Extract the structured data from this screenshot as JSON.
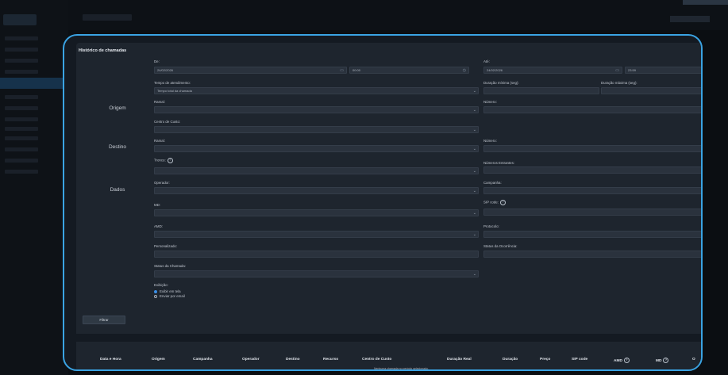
{
  "panel": {
    "title": "Histórico de chamadas"
  },
  "sections": {
    "origem": "Origem",
    "destino": "Destino",
    "dados": "Dados"
  },
  "filters": {
    "de_label": "De:",
    "de_date": "24/02/2026",
    "de_time": "00:00",
    "ate_label": "Até:",
    "ate_date": "24/02/2026",
    "ate_time": "23:59",
    "tempo_label": "Tempo de atendimento:",
    "tempo_value": "Tempo total da chamada",
    "dur_min_label": "Duração mínima (seg):",
    "dur_max_label": "Duração máxima (seg):",
    "origem_ramal_label": "Ramal:",
    "origem_numero_label": "Número:",
    "centro_label": "Centro de Custo:",
    "destino_ramal_label": "Ramal:",
    "destino_numero_label": "Número:",
    "tronco_label": "Tronco:",
    "entrantes_label": "Números Entrantes:",
    "operador_label": "Operador:",
    "campanha_label": "Campanha:",
    "md_label": "MD:",
    "sip_label": "SIP code:",
    "amd_label": "AMD:",
    "protocolo_label": "Protocolo:",
    "personalizado_label": "Personalizado:",
    "status_ocorrencia_label": "Status da Ocorrência:",
    "status_chamada_label": "Status da Chamada:",
    "exibicao_label": "Exibição:",
    "exibir_tela": "Exibir em tela",
    "enviar_email": "Enviar por email",
    "filter_button": "Filtrar"
  },
  "table": {
    "columns": [
      "Data e Hora",
      "Origem",
      "Campanha",
      "Operador",
      "Destino",
      "Recurso",
      "Centro de Custo",
      "Duração Real",
      "Duração",
      "Preço",
      "SIP code",
      "AMD",
      "MD",
      "O"
    ],
    "empty_message": "Nenhuma chamada no período selecionado."
  },
  "colors": {
    "highlight": "#3aa3e3",
    "panel": "#1e252e",
    "field": "#2a323d",
    "radio_selected": "#3a8ee6"
  }
}
